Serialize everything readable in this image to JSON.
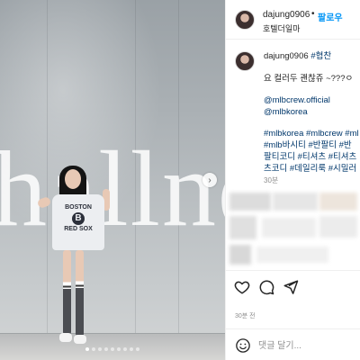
{
  "post": {
    "author": {
      "username": "dajung0906",
      "follow_separator": "•",
      "follow_label": "팔로우",
      "location": "호텔더일마"
    },
    "caption": {
      "username": "dajung0906",
      "tag_inline": "#협찬",
      "lines": [
        "요 컬러두 괜찮쥬 ~???ㅇ",
        "@mlbcrew.official",
        "@mlbkorea",
        "#mlbkorea #mlbcrew #ml",
        "#mlb바시티 #반팔티 #반",
        "팔티코디 #티셔츠 #티셔츠",
        "츠코디 #데일리룩 #시밀러"
      ],
      "time_ago": "30분"
    },
    "actions": {
      "like_icon": "heart-icon",
      "comment_icon": "comment-icon",
      "share_icon": "send-icon",
      "age_label": "30분 전"
    },
    "comment_box": {
      "emoji_icon": "smiley-icon",
      "placeholder": "댓글 달기..."
    },
    "media": {
      "sign_text": "hallnd",
      "shirt_text_top": "BOSTON",
      "shirt_logo": "B",
      "shirt_text_bottom": "RED SOX",
      "next_icon": "chevron-right-icon",
      "slides_count": 9,
      "active_slide": 0
    },
    "colors": {
      "link": "#00376b",
      "follow": "#0095f6",
      "muted": "#8e8e8e"
    }
  }
}
